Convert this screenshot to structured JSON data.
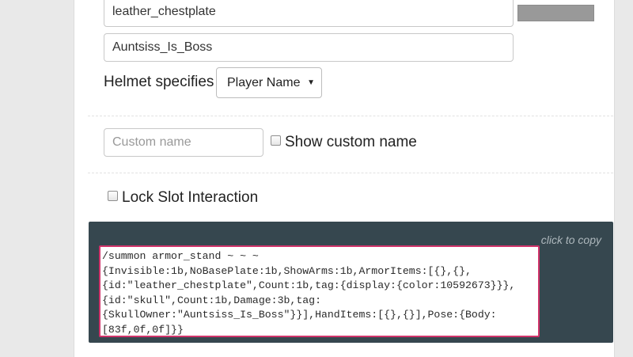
{
  "form": {
    "item_value": "leather_chestplate",
    "owner_value": "Auntsiss_Is_Boss",
    "helmet_label": "Helmet specifies",
    "helmet_select": "Player Name",
    "dropdown_arrow": "▼",
    "swatch_color": "#999999",
    "custom_name_placeholder": "Custom name",
    "show_custom_name_label": "Show custom name",
    "lock_slot_label": "Lock Slot Interaction"
  },
  "command": {
    "copy_hint": "click to copy",
    "lines": [
      "/summon armor_stand ~ ~ ~",
      "{Invisible:1b,NoBasePlate:1b,ShowArms:1b,ArmorItems:[{},{},",
      "{id:\"leather_chestplate\",Count:1b,tag:{display:{color:10592673}}},",
      "{id:\"skull\",Count:1b,Damage:3b,tag:",
      "{SkullOwner:\"Auntsiss_Is_Boss\"}}],HandItems:[{},{}],Pose:{Body:",
      "[83f,0f,0f]}}"
    ]
  }
}
